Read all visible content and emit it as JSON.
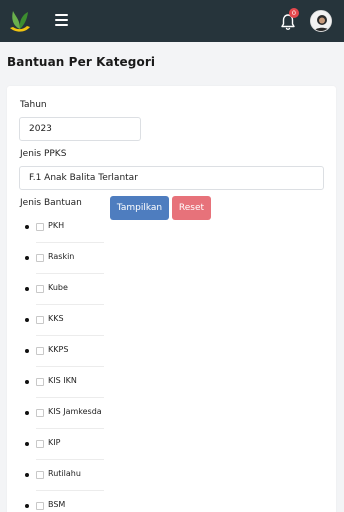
{
  "header": {
    "logo_icon": "leaf-hand-logo-icon",
    "menu_icon": "hamburger-menu-icon",
    "notification_icon": "bell-icon",
    "notification_count": "0",
    "avatar_icon": "user-avatar-icon",
    "bg_color": "#26343b"
  },
  "page": {
    "title": "Bantuan Per Kategori"
  },
  "form": {
    "tahun_label": "Tahun",
    "tahun_value": "2023",
    "jenis_ppks_label": "Jenis PPKS",
    "jenis_ppks_value": "F.1 Anak Balita Terlantar",
    "jenis_bantuan_label": "Jenis Bantuan",
    "tampilkan_label": "Tampilkan",
    "reset_label": "Reset",
    "primary_color": "#4e7dbf",
    "reset_color": "#e7727a"
  },
  "bantuan_items": [
    {
      "label": "PKH",
      "checked": false
    },
    {
      "label": "Raskin",
      "checked": false
    },
    {
      "label": "Kube",
      "checked": false
    },
    {
      "label": "KKS",
      "checked": false
    },
    {
      "label": "KKPS",
      "checked": false
    },
    {
      "label": "KIS IKN",
      "checked": false
    },
    {
      "label": "KIS Jamkesda",
      "checked": false
    },
    {
      "label": "KIP",
      "checked": false
    },
    {
      "label": "Rutilahu",
      "checked": false
    },
    {
      "label": "BSM",
      "checked": false
    }
  ]
}
